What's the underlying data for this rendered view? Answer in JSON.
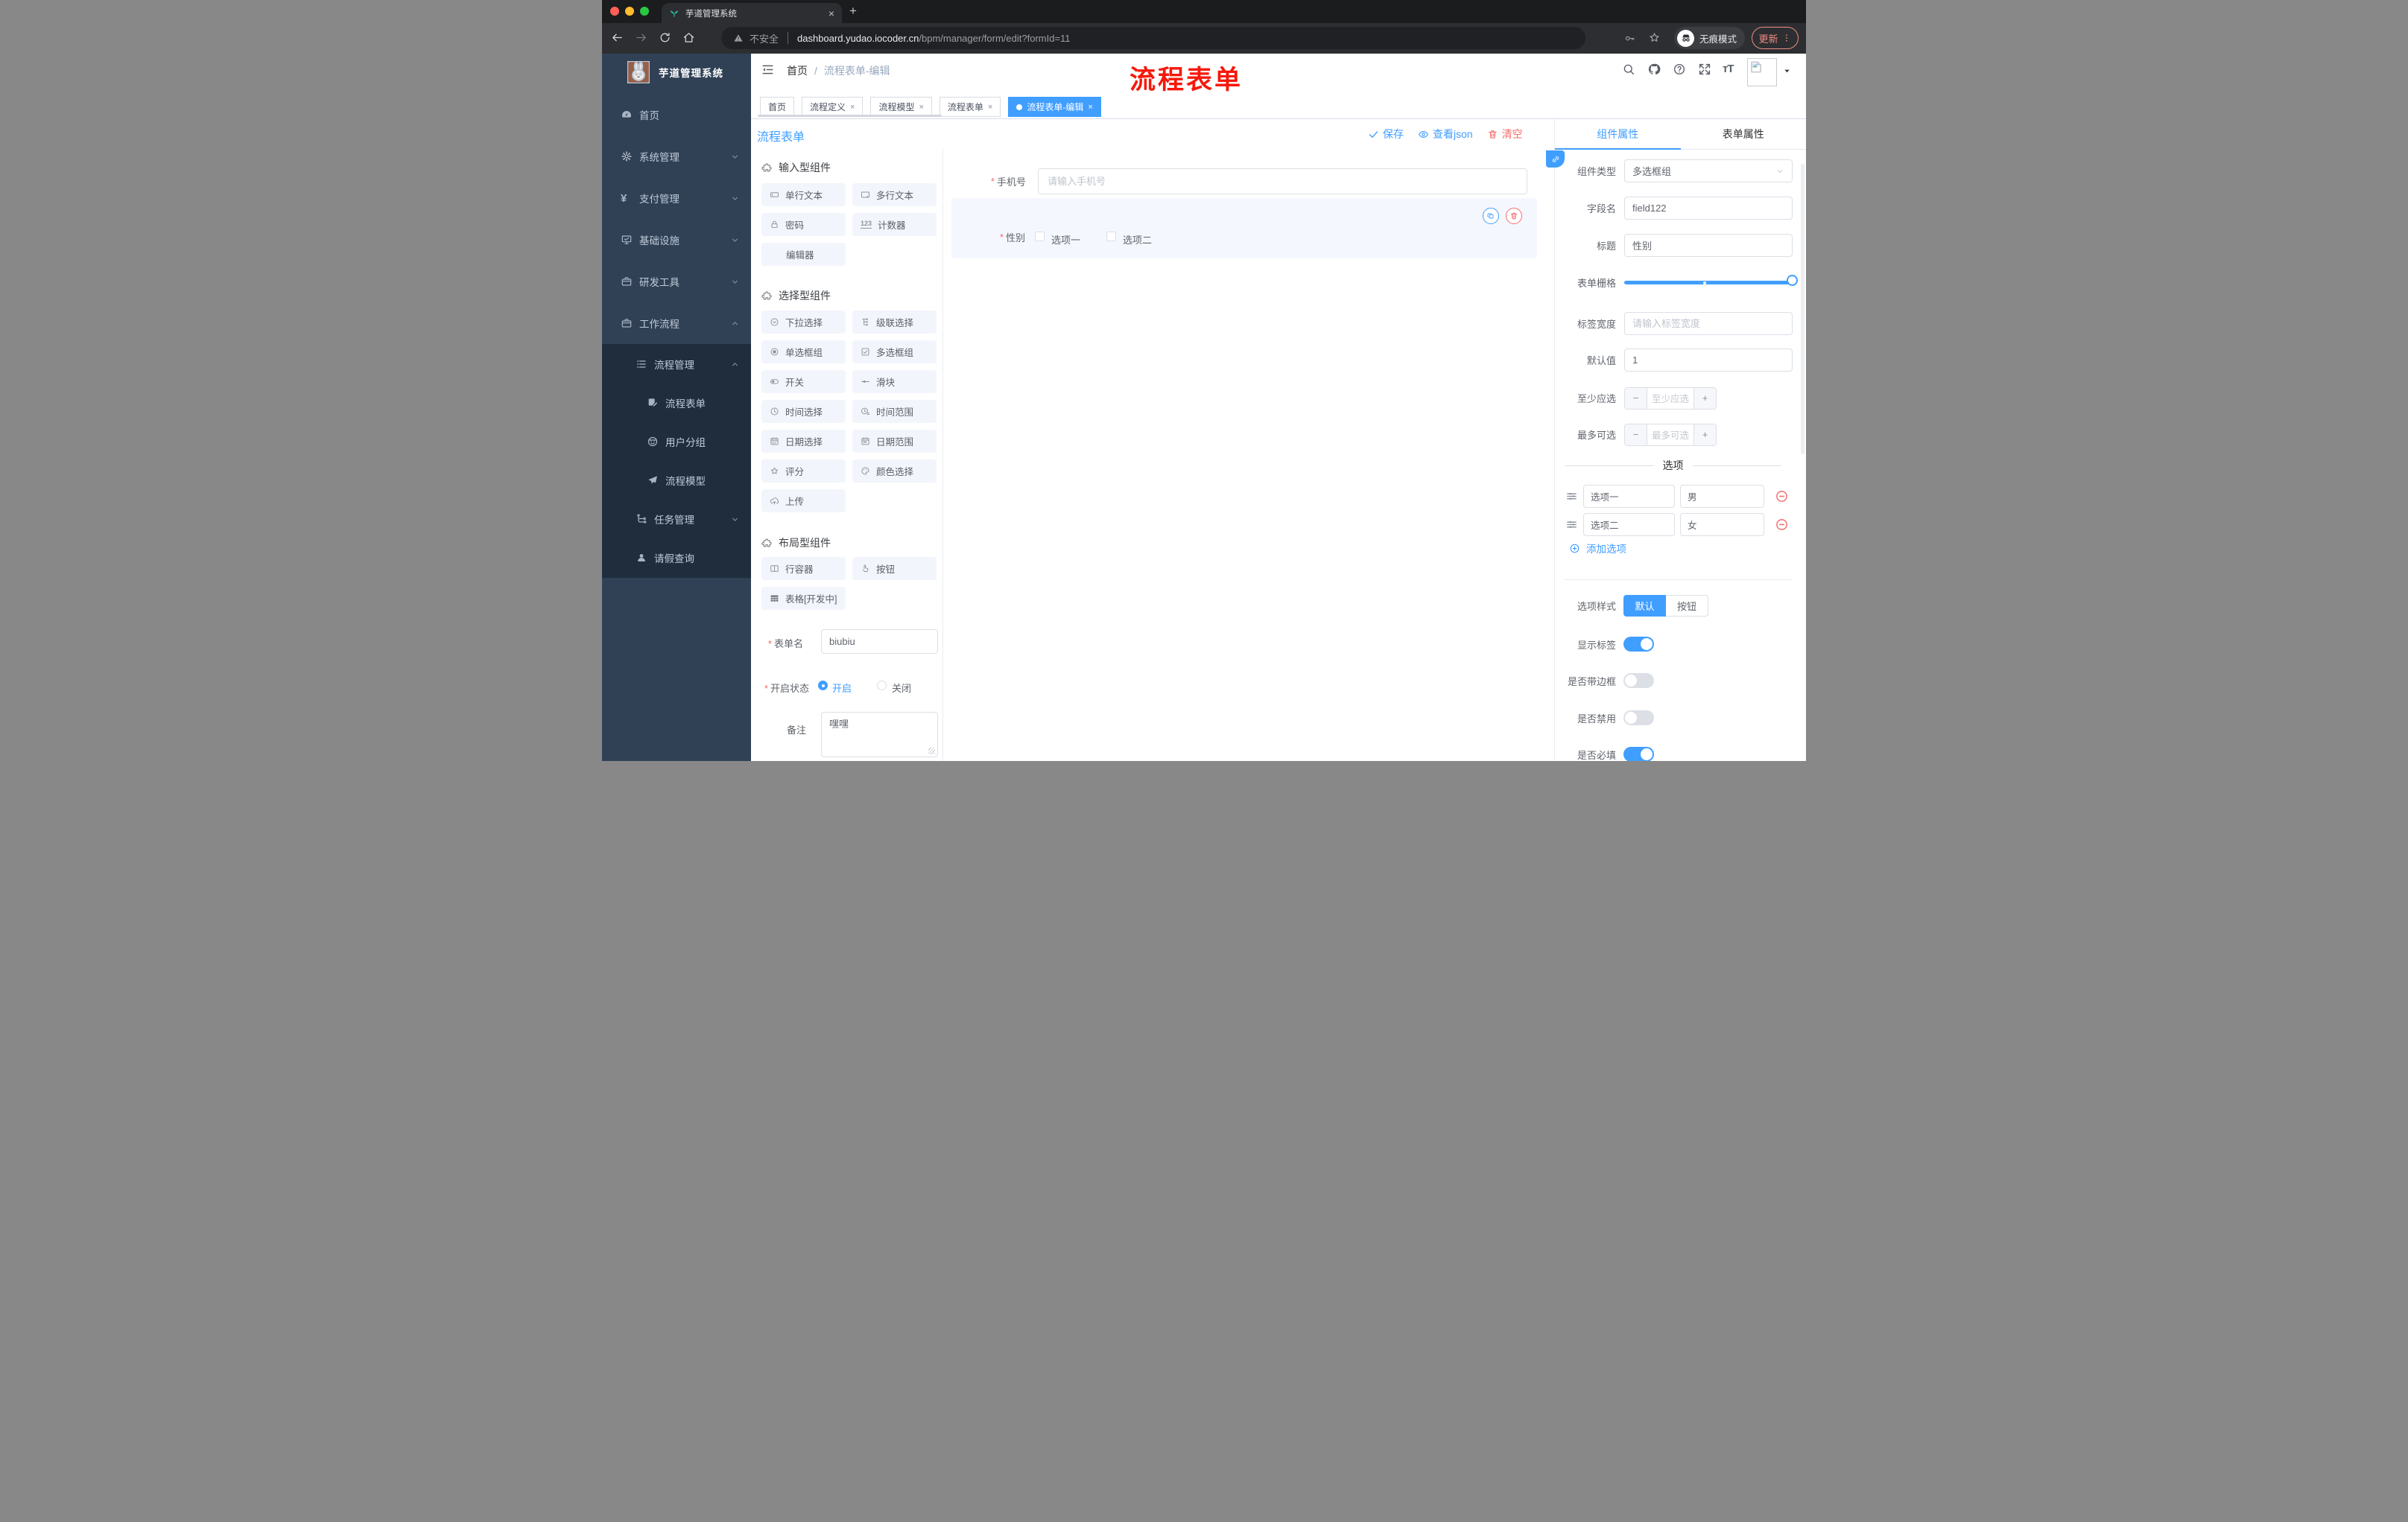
{
  "colors": {
    "accent": "#409eff",
    "danger": "#f56c6c",
    "sidebar_bg": "#304156",
    "submenu_bg": "#1f2d3d",
    "annotation_red": "#f5190b",
    "chrome_update": "#f08b82"
  },
  "browser": {
    "tab_title": "芋道管理系统",
    "security": "不安全",
    "url_host": "dashboard.yudao.iocoder.cn",
    "url_path": "/bpm/manager/form/edit?formId=11",
    "incognito": "无痕模式",
    "update": "更新"
  },
  "annotation": {
    "text": "流程表单"
  },
  "sidebar": {
    "title": "芋道管理系统",
    "items": [
      {
        "label": "首页"
      },
      {
        "label": "系统管理"
      },
      {
        "label": "支付管理"
      },
      {
        "label": "基础设施"
      },
      {
        "label": "研发工具"
      },
      {
        "label": "工作流程"
      }
    ],
    "submenu": [
      {
        "label": "流程管理"
      },
      {
        "label": "流程表单"
      },
      {
        "label": "用户分组"
      },
      {
        "label": "流程模型"
      },
      {
        "label": "任务管理"
      },
      {
        "label": "请假查询"
      }
    ]
  },
  "header": {
    "breadcrumb_home": "首页",
    "breadcrumb_current": "流程表单-编辑"
  },
  "tags": [
    {
      "label": "首页"
    },
    {
      "label": "流程定义"
    },
    {
      "label": "流程模型"
    },
    {
      "label": "流程表单"
    },
    {
      "label": "流程表单-编辑"
    }
  ],
  "toolbar": {
    "title": "流程表单",
    "save": "保存",
    "view_json": "查看json",
    "clear": "清空"
  },
  "palette": {
    "sections": [
      {
        "title": "输入型组件",
        "items": [
          "单行文本",
          "多行文本",
          "密码",
          "计数器",
          "编辑器"
        ]
      },
      {
        "title": "选择型组件",
        "items": [
          "下拉选择",
          "级联选择",
          "单选框组",
          "多选框组",
          "开关",
          "滑块",
          "时间选择",
          "时间范围",
          "日期选择",
          "日期范围",
          "评分",
          "颜色选择",
          "上传"
        ]
      },
      {
        "title": "布局型组件",
        "items": [
          "行容器",
          "按钮",
          "表格[开发中]"
        ]
      }
    ],
    "form": {
      "name_label": "表单名",
      "name_value": "biubiu",
      "status_label": "开启状态",
      "status_on": "开启",
      "status_off": "关闭",
      "remark_label": "备注",
      "remark_value": "嘿嘿"
    }
  },
  "canvas": {
    "phone_label": "手机号",
    "phone_placeholder": "请输入手机号",
    "gender_label": "性别",
    "gender_opt1": "选项一",
    "gender_opt2": "选项二"
  },
  "props": {
    "tab_component": "组件属性",
    "tab_form": "表单属性",
    "component_type_label": "组件类型",
    "component_type_value": "多选框组",
    "field_label": "字段名",
    "field_value": "field122",
    "title_label": "标题",
    "title_value": "性别",
    "grid_label": "表单栅格",
    "label_width_label": "标签宽度",
    "label_width_placeholder": "请输入标签宽度",
    "default_label": "默认值",
    "default_value": "1",
    "min_label": "至少应选",
    "min_placeholder": "至少应选",
    "max_label": "最多可选",
    "max_placeholder": "最多可选",
    "options_title": "选项",
    "options": [
      {
        "label": "选项一",
        "value": "男"
      },
      {
        "label": "选项二",
        "value": "女"
      }
    ],
    "add_option": "添加选项",
    "style_label": "选项样式",
    "style_default": "默认",
    "style_button": "按钮",
    "show_label_label": "显示标签",
    "border_label": "是否带边框",
    "disabled_label": "是否禁用",
    "required_label": "是否必填"
  }
}
